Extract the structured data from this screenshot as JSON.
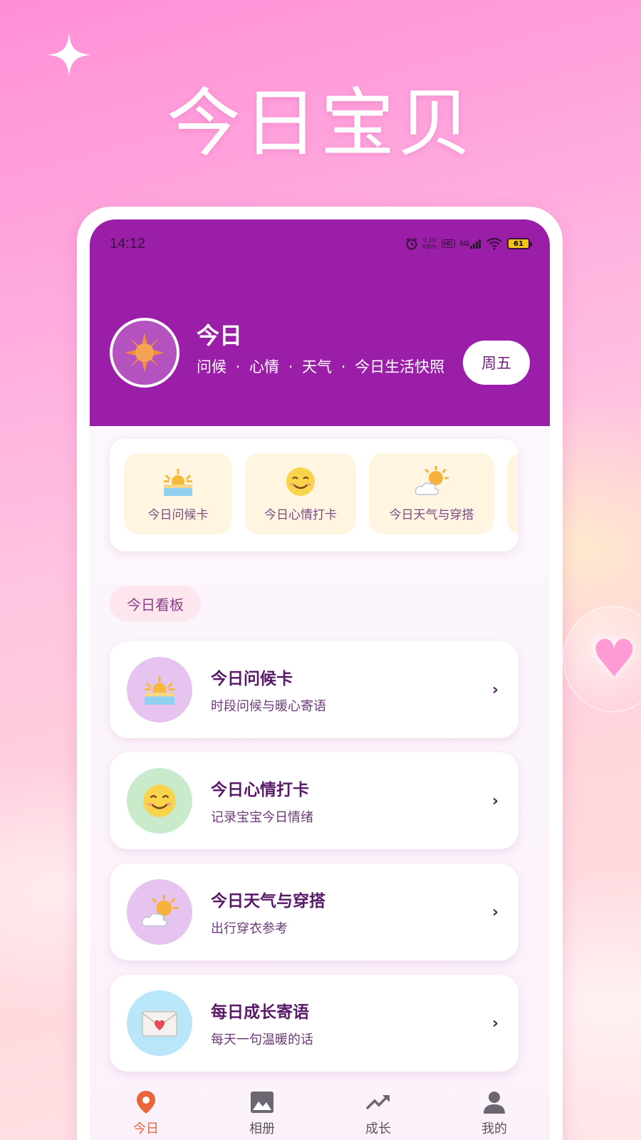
{
  "promo": {
    "title": "今日宝贝"
  },
  "status_bar": {
    "time": "14:12",
    "net_speed_value": "0.10",
    "net_speed_unit": "KB/s",
    "hd": "HD",
    "network": "5G",
    "battery": "61"
  },
  "header": {
    "title": "今日",
    "subtitle": "问候 · 心情 · 天气 · 今日生活快照",
    "weekday": "周五",
    "avatar_icon": "sun-icon",
    "bg_color": "#9a1ea8"
  },
  "quick_actions": [
    {
      "label": "今日问候卡",
      "icon": "sunrise-icon"
    },
    {
      "label": "今日心情打卡",
      "icon": "smile-icon"
    },
    {
      "label": "今日天气与穿搭",
      "icon": "sun-behind-cloud-icon"
    }
  ],
  "section": {
    "label": "今日看板"
  },
  "cards": [
    {
      "title": "今日问候卡",
      "subtitle": "时段问候与暖心寄语",
      "icon": "sunrise-icon",
      "icon_bg": "#e6c4ef"
    },
    {
      "title": "今日心情打卡",
      "subtitle": "记录宝宝今日情绪",
      "icon": "smile-icon",
      "icon_bg": "#c9ebcb"
    },
    {
      "title": "今日天气与穿搭",
      "subtitle": "出行穿衣参考",
      "icon": "sun-behind-cloud-icon",
      "icon_bg": "#e6c4ef"
    },
    {
      "title": "每日成长寄语",
      "subtitle": "每天一句温暖的话",
      "icon": "love-letter-icon",
      "icon_bg": "#b9e6f8"
    }
  ],
  "chevron": "›",
  "nav": [
    {
      "label": "今日",
      "icon": "location-pin-icon",
      "active": true
    },
    {
      "label": "相册",
      "icon": "image-icon",
      "active": false
    },
    {
      "label": "成长",
      "icon": "trending-up-icon",
      "active": false
    },
    {
      "label": "我的",
      "icon": "person-icon",
      "active": false
    }
  ],
  "colors": {
    "accent": "#9a1ea8",
    "nav_active": "#e8663a",
    "text_dark": "#5a1a6a"
  }
}
